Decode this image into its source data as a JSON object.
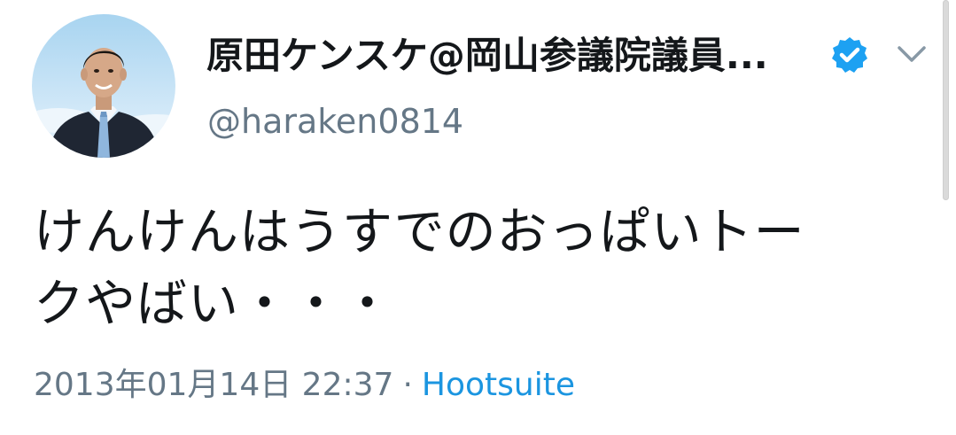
{
  "tweet": {
    "display_name": "原田ケンスケ@岡山参議院議員...",
    "handle": "@haraken0814",
    "verified": true,
    "text_line1": "けんけんはうすでのおっぱいトー",
    "text_line2": "クやばい・・・",
    "timestamp": "2013年01月14日 22:37",
    "separator": "·",
    "source": "Hootsuite"
  },
  "icons": {
    "avatar": "profile-photo",
    "verified": "verified-badge-icon",
    "caret": "chevron-down-icon"
  },
  "colors": {
    "text": "#14171a",
    "secondary": "#657786",
    "link": "#1b95e0",
    "verified": "#1da1f2"
  }
}
